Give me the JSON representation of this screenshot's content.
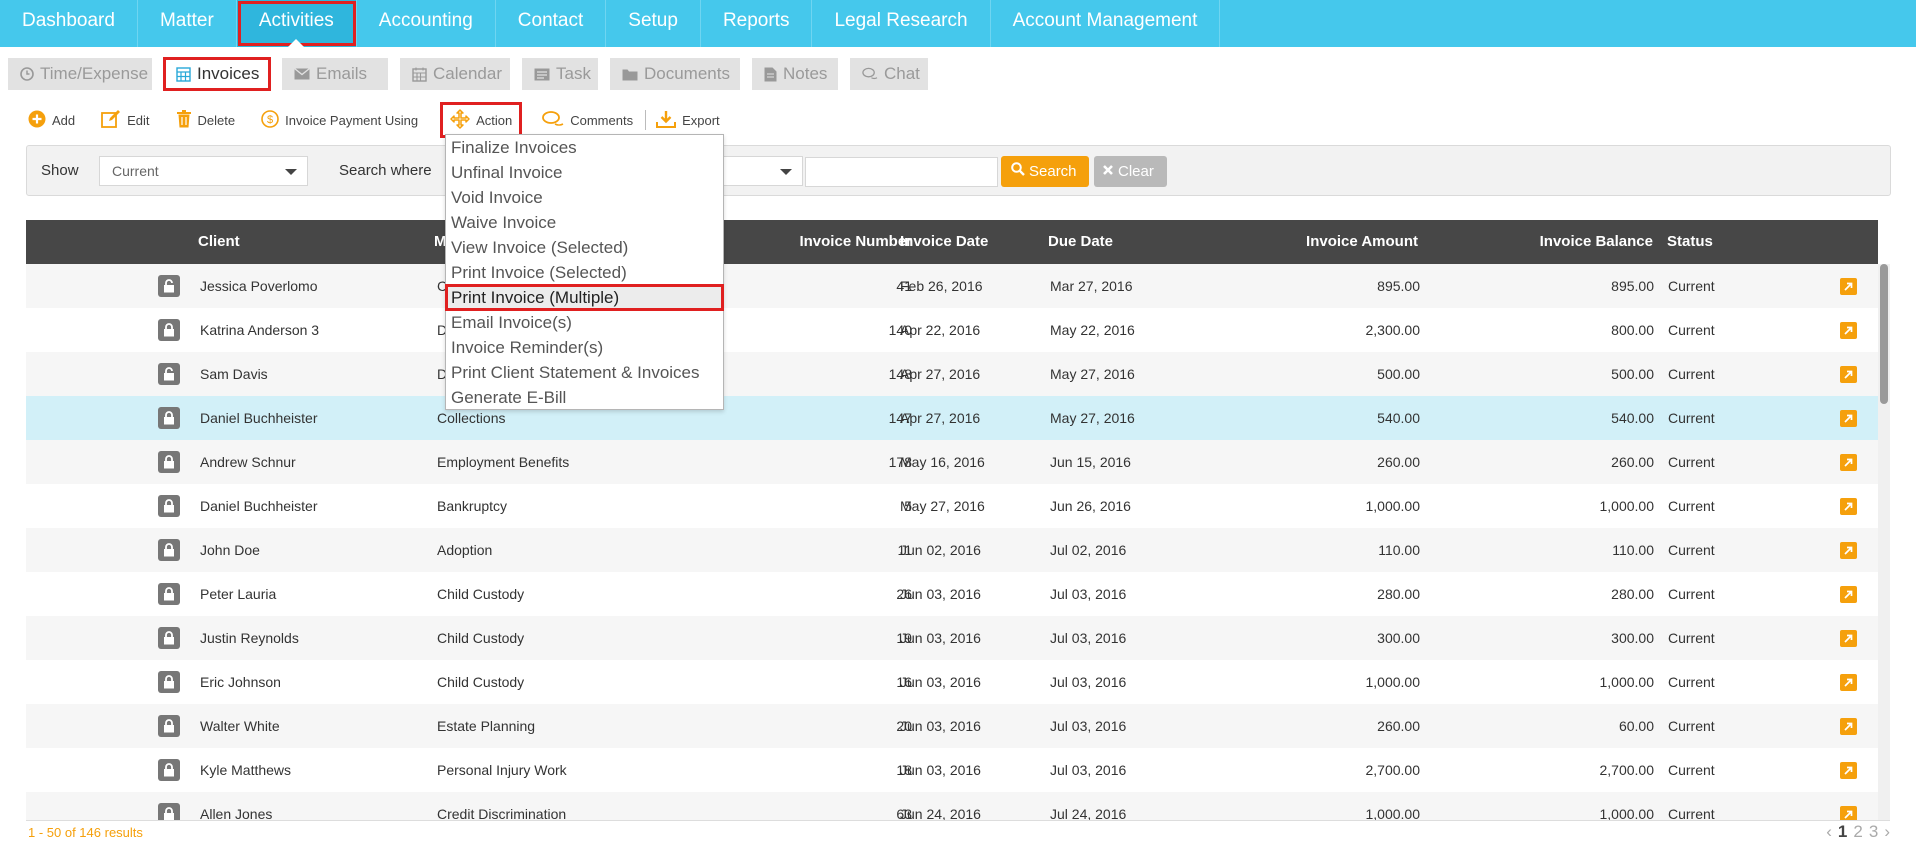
{
  "nav": {
    "items": [
      {
        "label": "Dashboard"
      },
      {
        "label": "Matter"
      },
      {
        "label": "Activities"
      },
      {
        "label": "Accounting"
      },
      {
        "label": "Contact"
      },
      {
        "label": "Setup"
      },
      {
        "label": "Reports"
      },
      {
        "label": "Legal Research"
      },
      {
        "label": "Account Management"
      }
    ],
    "active": "Activities"
  },
  "subtabs": [
    {
      "label": "Time/Expense",
      "icon": "clock-icon"
    },
    {
      "label": "Invoices",
      "icon": "calculator-icon"
    },
    {
      "label": "Emails",
      "icon": "envelope-icon"
    },
    {
      "label": "Calendar",
      "icon": "calendar-icon"
    },
    {
      "label": "Task",
      "icon": "task-icon"
    },
    {
      "label": "Documents",
      "icon": "folder-icon"
    },
    {
      "label": "Notes",
      "icon": "note-icon"
    },
    {
      "label": "Chat",
      "icon": "chat-icon"
    }
  ],
  "toolbar": {
    "add": "Add",
    "edit": "Edit",
    "delete": "Delete",
    "payment": "Invoice Payment Using",
    "action": "Action",
    "comments": "Comments",
    "export": "Export"
  },
  "filter": {
    "show_label": "Show",
    "show_value": "Current",
    "search_where_label": "Search where",
    "search_value": "",
    "search_button": "Search",
    "clear_button": "Clear"
  },
  "action_menu": [
    "Finalize Invoices",
    "Unfinal Invoice",
    "Void Invoice",
    "Waive Invoice",
    "View Invoice (Selected)",
    "Print Invoice (Selected)",
    "Print Invoice (Multiple)",
    "Email Invoice(s)",
    "Invoice Reminder(s)",
    "Print Client Statement & Invoices",
    "Generate E-Bill"
  ],
  "table": {
    "headers": {
      "client": "Client",
      "matter": "M",
      "invoice_number": "Invoice Number",
      "invoice_date": "Invoice Date",
      "due_date": "Due Date",
      "invoice_amount": "Invoice Amount",
      "invoice_balance": "Invoice Balance",
      "status": "Status"
    },
    "rows": [
      {
        "client": "Jessica Poverlomo",
        "matter": "C",
        "number": "41",
        "inv_date": "Feb 26, 2016",
        "due": "Mar 27, 2016",
        "amount": "895.00",
        "balance": "895.00",
        "status": "Current",
        "lock": "unlocked"
      },
      {
        "client": "Katrina Anderson 3",
        "matter": "D",
        "number": "140",
        "inv_date": "Apr 22, 2016",
        "due": "May 22, 2016",
        "amount": "2,300.00",
        "balance": "800.00",
        "status": "Current",
        "lock": "locked"
      },
      {
        "client": "Sam Davis",
        "matter": "D",
        "number": "148",
        "inv_date": "Apr 27, 2016",
        "due": "May 27, 2016",
        "amount": "500.00",
        "balance": "500.00",
        "status": "Current",
        "lock": "unlocked"
      },
      {
        "client": "Daniel Buchheister",
        "matter": "Collections",
        "number": "147",
        "inv_date": "Apr 27, 2016",
        "due": "May 27, 2016",
        "amount": "540.00",
        "balance": "540.00",
        "status": "Current",
        "lock": "locked"
      },
      {
        "client": "Andrew Schnur",
        "matter": "Employment Benefits",
        "number": "178",
        "inv_date": "May 16, 2016",
        "due": "Jun 15, 2016",
        "amount": "260.00",
        "balance": "260.00",
        "status": "Current",
        "lock": "locked"
      },
      {
        "client": "Daniel Buchheister",
        "matter": "Bankruptcy",
        "number": "5",
        "inv_date": "May 27, 2016",
        "due": "Jun 26, 2016",
        "amount": "1,000.00",
        "balance": "1,000.00",
        "status": "Current",
        "lock": "locked"
      },
      {
        "client": "John Doe",
        "matter": "Adoption",
        "number": "11",
        "inv_date": "Jun 02, 2016",
        "due": "Jul 02, 2016",
        "amount": "110.00",
        "balance": "110.00",
        "status": "Current",
        "lock": "locked"
      },
      {
        "client": "Peter Lauria",
        "matter": "Child Custody",
        "number": "26",
        "inv_date": "Jun 03, 2016",
        "due": "Jul 03, 2016",
        "amount": "280.00",
        "balance": "280.00",
        "status": "Current",
        "lock": "locked"
      },
      {
        "client": "Justin Reynolds",
        "matter": "Child Custody",
        "number": "19",
        "inv_date": "Jun 03, 2016",
        "due": "Jul 03, 2016",
        "amount": "300.00",
        "balance": "300.00",
        "status": "Current",
        "lock": "locked"
      },
      {
        "client": "Eric Johnson",
        "matter": "Child Custody",
        "number": "16",
        "inv_date": "Jun 03, 2016",
        "due": "Jul 03, 2016",
        "amount": "1,000.00",
        "balance": "1,000.00",
        "status": "Current",
        "lock": "locked"
      },
      {
        "client": "Walter White",
        "matter": "Estate Planning",
        "number": "20",
        "inv_date": "Jun 03, 2016",
        "due": "Jul 03, 2016",
        "amount": "260.00",
        "balance": "60.00",
        "status": "Current",
        "lock": "locked"
      },
      {
        "client": "Kyle Matthews",
        "matter": "Personal Injury Work",
        "number": "18",
        "inv_date": "Jun 03, 2016",
        "due": "Jul 03, 2016",
        "amount": "2,700.00",
        "balance": "2,700.00",
        "status": "Current",
        "lock": "locked"
      },
      {
        "client": "Allen Jones",
        "matter": "Credit Discrimination",
        "number": "63",
        "inv_date": "Jun 24, 2016",
        "due": "Jul 24, 2016",
        "amount": "1,000.00",
        "balance": "1,000.00",
        "status": "Current",
        "lock": "locked"
      }
    ],
    "selected_row": 3
  },
  "footer": {
    "results": "1 - 50 of 146 results",
    "prev": "‹",
    "pages": [
      "1",
      "2",
      "3"
    ],
    "next": "›"
  },
  "colors": {
    "nav_bg": "#45c8ec",
    "accent": "#f5a00c",
    "header_bg": "#474747",
    "selected_row": "#d2f0f8",
    "highlight_box": "#e02020"
  }
}
